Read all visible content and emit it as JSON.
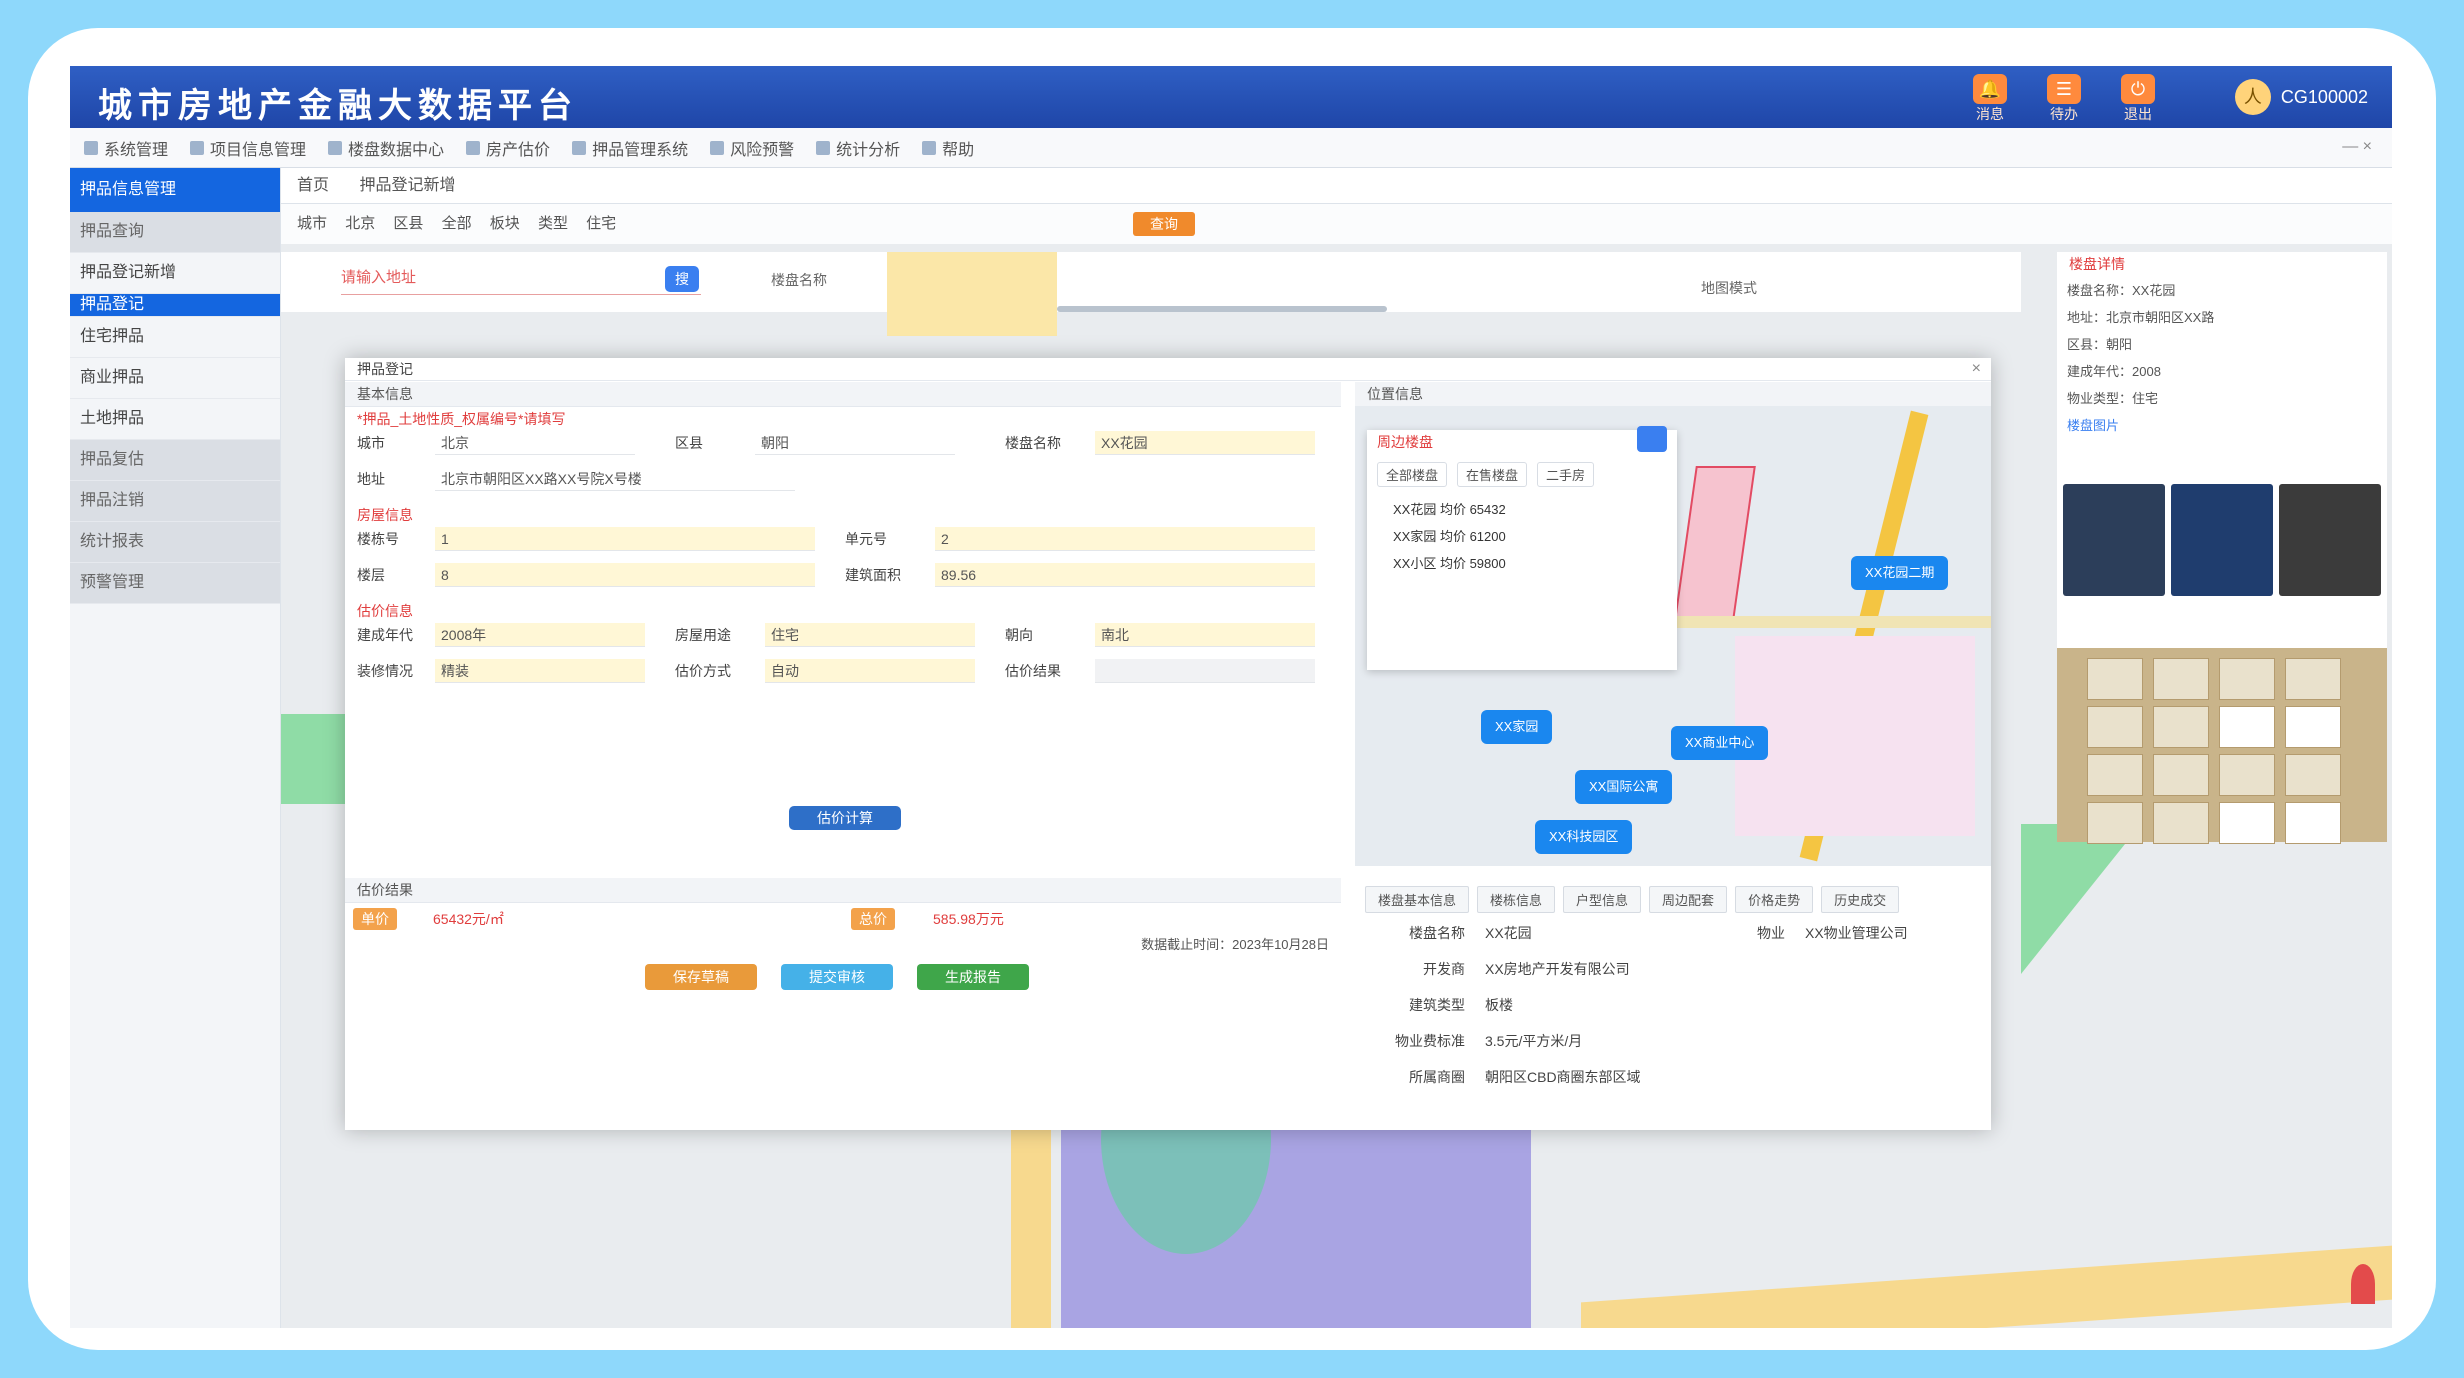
{
  "app": {
    "title": "城市房地产金融大数据平台",
    "toolbar_buttons": [
      {
        "label": "消息",
        "icon": "bell-icon"
      },
      {
        "label": "待办",
        "icon": "task-icon"
      },
      {
        "label": "退出",
        "icon": "exit-icon"
      }
    ],
    "user": {
      "name": "CG100002",
      "avatar": "人"
    }
  },
  "menu": {
    "items": [
      "系统管理",
      "项目信息管理",
      "楼盘数据中心",
      "房产估价",
      "押品管理系统",
      "风险预警",
      "统计分析",
      "帮助"
    ],
    "window_controls": "— ×"
  },
  "sidebar": {
    "header": "押品信息管理",
    "items": [
      {
        "label": "押品查询",
        "style": "grey"
      },
      {
        "label": "押品登记新增",
        "style": "normal"
      },
      {
        "label": "押品登记",
        "style": "active"
      },
      {
        "label": "住宅押品",
        "style": "normal"
      },
      {
        "label": "商业押品",
        "style": "normal"
      },
      {
        "label": "土地押品",
        "style": "normal"
      },
      {
        "label": "押品复估",
        "style": "grey"
      },
      {
        "label": "押品注销",
        "style": "grey"
      },
      {
        "label": "统计报表",
        "style": "grey"
      },
      {
        "label": "预警管理",
        "style": "grey"
      }
    ]
  },
  "breadcrumbs": [
    "首页",
    "押品登记新增"
  ],
  "filter": {
    "items": [
      "城市",
      "北京",
      "区县",
      "全部",
      "板块",
      "类型",
      "住宅"
    ],
    "query_label": "查询"
  },
  "strip": {
    "search_placeholder": "请输入地址",
    "search_btn": "搜",
    "mid_label": "楼盘名称",
    "right_label": "地图模式"
  },
  "dialog": {
    "title": "押品登记",
    "left_title": "基本信息",
    "red_notice": "*押品_土地性质_权属编号*请填写",
    "fields_row1": [
      {
        "label": "城市",
        "value": "北京",
        "style": "plain"
      },
      {
        "label": "区县",
        "value": "朝阳",
        "style": "plain"
      },
      {
        "label": "楼盘名称",
        "value": "XX花园",
        "style": "yellow"
      }
    ],
    "address_label": "地址",
    "address_value": "北京市朝阳区XX路XX号院X号楼",
    "section2": "房屋信息",
    "fields_row2": [
      {
        "label": "楼栋号",
        "value": "1",
        "style": "yellow"
      },
      {
        "label": "单元号",
        "value": "2",
        "style": "yellow"
      }
    ],
    "fields_row3": [
      {
        "label": "楼层",
        "value": "8",
        "style": "yellow"
      },
      {
        "label": "建筑面积",
        "value": "89.56",
        "style": "yellow"
      }
    ],
    "section3": "估价信息",
    "fields_row4": [
      {
        "label": "建成年代",
        "value": "2008年",
        "style": "yellow"
      },
      {
        "label": "房屋用途",
        "value": "住宅",
        "style": "yellow"
      },
      {
        "label": "朝向",
        "value": "南北",
        "style": "yellow"
      }
    ],
    "fields_row5": [
      {
        "label": "装修情况",
        "value": "精装",
        "style": "yellow"
      },
      {
        "label": "估价方式",
        "value": "自动",
        "style": "yellow"
      },
      {
        "label": "估价结果",
        "value": "",
        "style": "grey"
      }
    ],
    "center_button": "估价计算",
    "sub_title": "估价结果",
    "tag1": "单价",
    "red1": "65432元/㎡",
    "tag2": "总价",
    "red2": "585.98万元",
    "note": "数据截止时间：2023年10月28日",
    "actions": [
      {
        "label": "保存草稿",
        "color": "#e99a3a"
      },
      {
        "label": "提交审核",
        "color": "#45b1e8"
      },
      {
        "label": "生成报告",
        "color": "#3fa64a"
      }
    ],
    "map_title": "位置信息",
    "popup_title": "周边楼盘",
    "popup_tabs": [
      "全部楼盘",
      "在售楼盘",
      "二手房"
    ],
    "popup_lines": [
      "XX花园 均价 65432",
      "XX家园 均价 61200",
      "XX小区 均价 59800"
    ],
    "map_labels": [
      "XX花园二期",
      "XX家园",
      "XX商业中心",
      "XX国际公寓",
      "XX科技园区"
    ],
    "detail_tabs": [
      "楼盘基本信息",
      "楼栋信息",
      "户型信息",
      "周边配套",
      "价格走势",
      "历史成交"
    ],
    "detail_rows": [
      {
        "k": "楼盘名称",
        "v": "XX花园",
        "k2": "物业",
        "v2": "XX物业管理公司"
      },
      {
        "k": "开发商",
        "v": "XX房地产开发有限公司",
        "k2": "",
        "v2": ""
      },
      {
        "k": "建筑类型",
        "v": "板楼",
        "k2": "",
        "v2": ""
      },
      {
        "k": "物业费标准",
        "v": "3.5元/平方米/月",
        "k2": "",
        "v2": ""
      },
      {
        "k": "所属商圈",
        "v": "朝阳区CBD商圈东部区域",
        "k2": "",
        "v2": ""
      }
    ]
  },
  "side_info": {
    "title": "楼盘详情",
    "rows": [
      "楼盘名称：XX花园",
      "地址：北京市朝阳区XX路",
      "区县：朝阳",
      "建成年代：2008",
      "物业类型：住宅"
    ],
    "photo_label": "楼盘图片"
  }
}
